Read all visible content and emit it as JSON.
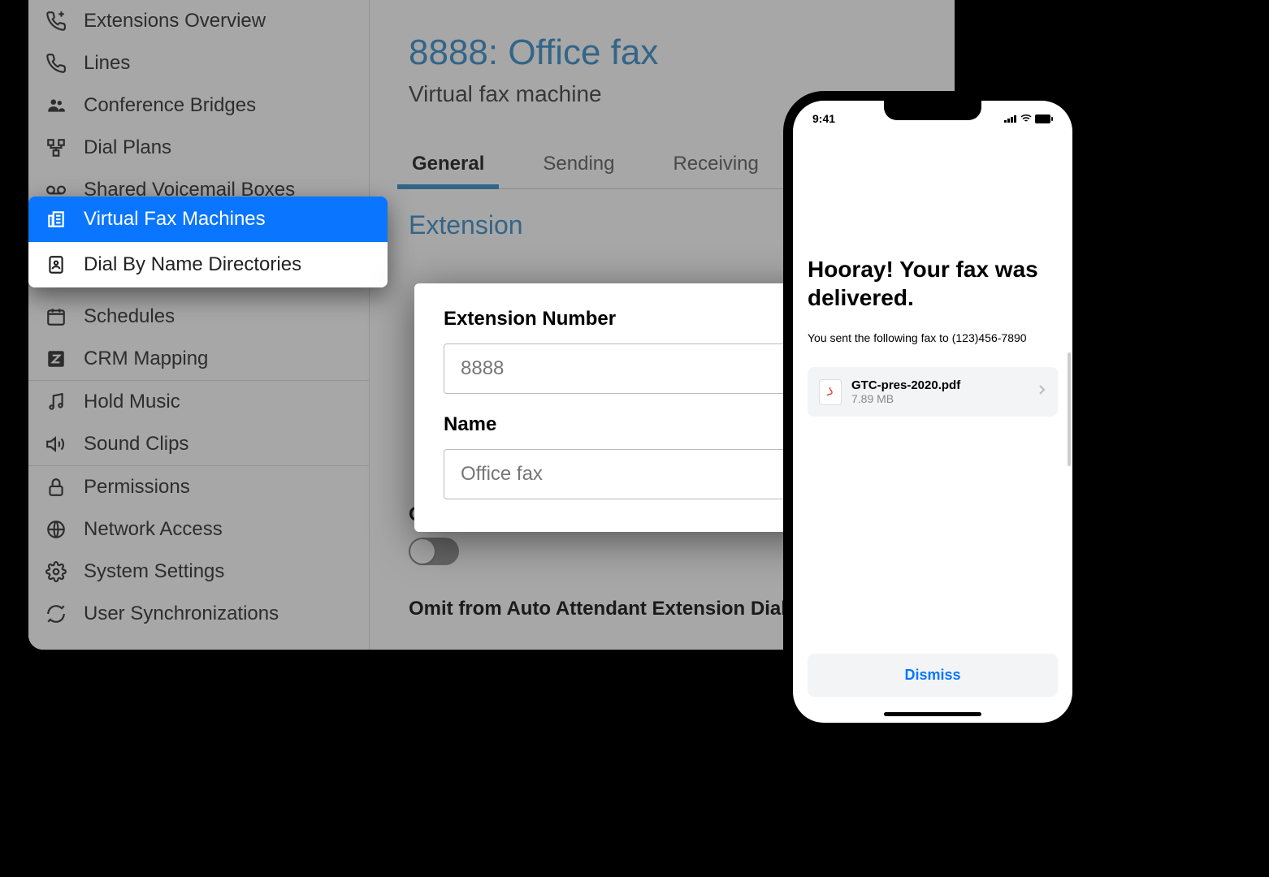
{
  "sidebar": {
    "items": [
      {
        "label": "Extensions Overview"
      },
      {
        "label": "Lines"
      },
      {
        "label": "Conference Bridges"
      },
      {
        "label": "Dial Plans"
      },
      {
        "label": "Shared Voicemail Boxes"
      },
      {
        "label": "Virtual Fax Machines"
      },
      {
        "label": "Dial By Name Directories"
      },
      {
        "label": "Schedules"
      },
      {
        "label": "CRM Mapping"
      },
      {
        "label": "Hold Music"
      },
      {
        "label": "Sound Clips"
      },
      {
        "label": "Permissions"
      },
      {
        "label": "Network Access"
      },
      {
        "label": "System Settings"
      },
      {
        "label": "User Synchronizations"
      }
    ]
  },
  "main": {
    "title": "8888: Office fax",
    "subtitle": "Virtual fax machine",
    "tabs": [
      {
        "label": "General"
      },
      {
        "label": "Sending"
      },
      {
        "label": "Receiving"
      }
    ],
    "section_title": "Extension",
    "ext_label": "Extension Number",
    "ext_value": "8888",
    "name_label": "Name",
    "name_value": "Office fax",
    "omit_dir_label": "Omit from Directory",
    "omit_aa_label": "Omit from Auto Attendant Extension Dialing"
  },
  "phone": {
    "time": "9:41",
    "headline": "Hooray! Your fax was delivered.",
    "subtext": "You sent the following fax to (123)456-7890",
    "file": {
      "name": "GTC-pres-2020.pdf",
      "size": "7.89 MB"
    },
    "dismiss": "Dismiss"
  }
}
